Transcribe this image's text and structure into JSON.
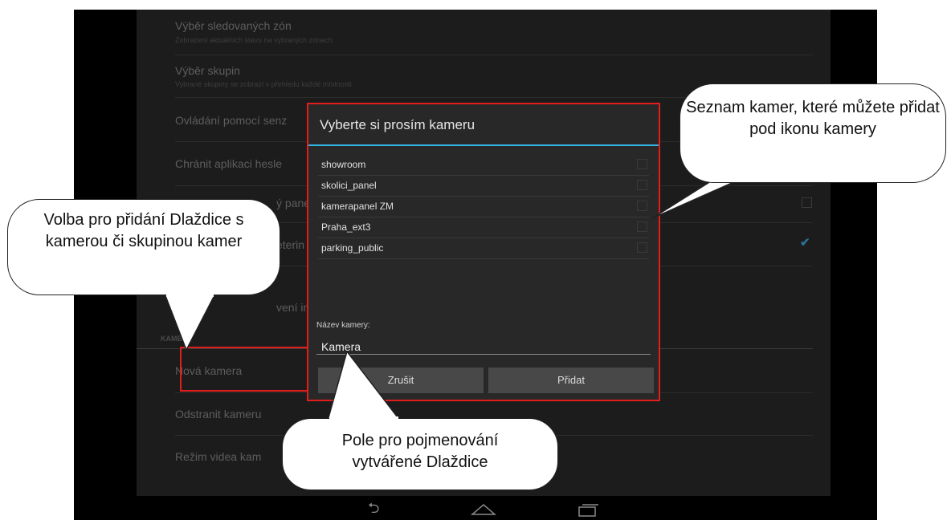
{
  "settings": {
    "rows": [
      {
        "title": "Výběr sledovaných zón",
        "subtitle": "Zobrazení aktuálních stavu na vybraných zónach."
      },
      {
        "title": "Výběr skupin",
        "subtitle": "Vybrané skupiny se zobrazí v přehledu každé místnosti"
      },
      {
        "title": "Ovládání pomocí senz"
      },
      {
        "title": "Chránit aplikaci hesle"
      },
      {
        "title": "ý pane"
      },
      {
        "title": "eterin"
      },
      {
        "title": "vení interkomu"
      },
      {
        "title": "Nová kamera"
      },
      {
        "title": "Odstranit kameru"
      },
      {
        "title": "Režim videa kam"
      }
    ],
    "section_label": "KAMB"
  },
  "dialog": {
    "title": "Vyberte si prosím kameru",
    "cameras": [
      "showroom",
      "skolici_panel",
      "kamerapanel ZM",
      "Praha_ext3",
      "parking_public"
    ],
    "name_label": "Název kamery:",
    "name_value": "Kamera",
    "cancel_label": "Zrušit",
    "add_label": "Přidat"
  },
  "navbar": {
    "back_icon": "back-icon",
    "home_icon": "home-icon",
    "recents_icon": "recents-icon"
  },
  "callouts": {
    "camera_list": "Seznam kamer, které můžete přidat pod ikonu kamery",
    "tile_option": "Volba pro přidání Dlaždice s kamerou či skupinou kamer",
    "name_field": "Pole pro pojmenování vytvářené Dlaždice"
  },
  "colors": {
    "accent": "#33b5e5",
    "highlight": "#e11d1d",
    "background": "#1c1c1c"
  }
}
